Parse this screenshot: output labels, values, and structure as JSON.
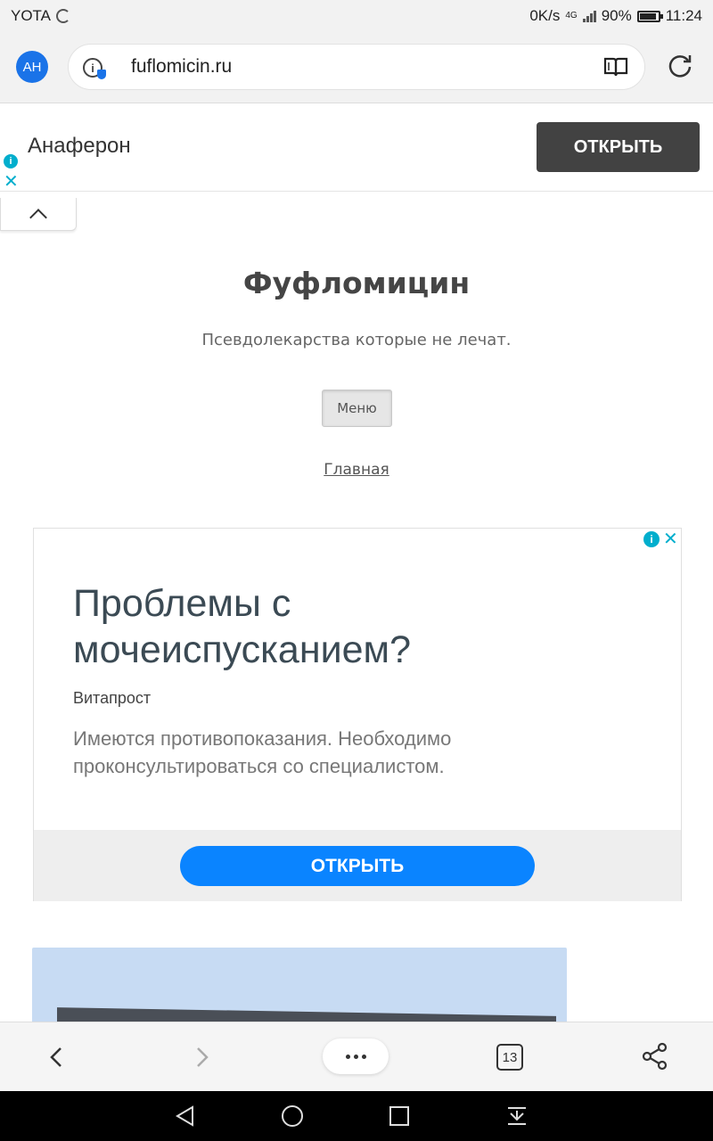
{
  "status_bar": {
    "carrier": "YOTA",
    "speed": "0K/s",
    "network": "4G",
    "battery_percent": "90%",
    "battery_level": 0.9,
    "time": "11:24"
  },
  "browser": {
    "avatar_initials": "AH",
    "url": "fuflomicin.ru",
    "tab_count": "13"
  },
  "top_ad": {
    "title": "Анаферон",
    "button_label": "ОТКРЫТЬ"
  },
  "site": {
    "title": "Фуфломицин",
    "description": "Псевдолекарства которые не лечат.",
    "menu_label": "Меню",
    "home_link": "Главная"
  },
  "main_ad": {
    "headline": "Проблемы с мочеиспусканием?",
    "brand": "Витапрост",
    "body": "Имеются противопоказания. Необходимо проконсультироваться со специалистом.",
    "button_label": "ОТКРЫТЬ"
  },
  "colors": {
    "accent_blue": "#0a84ff",
    "adchoices_cyan": "#00aecd",
    "dark_button": "#424242"
  }
}
